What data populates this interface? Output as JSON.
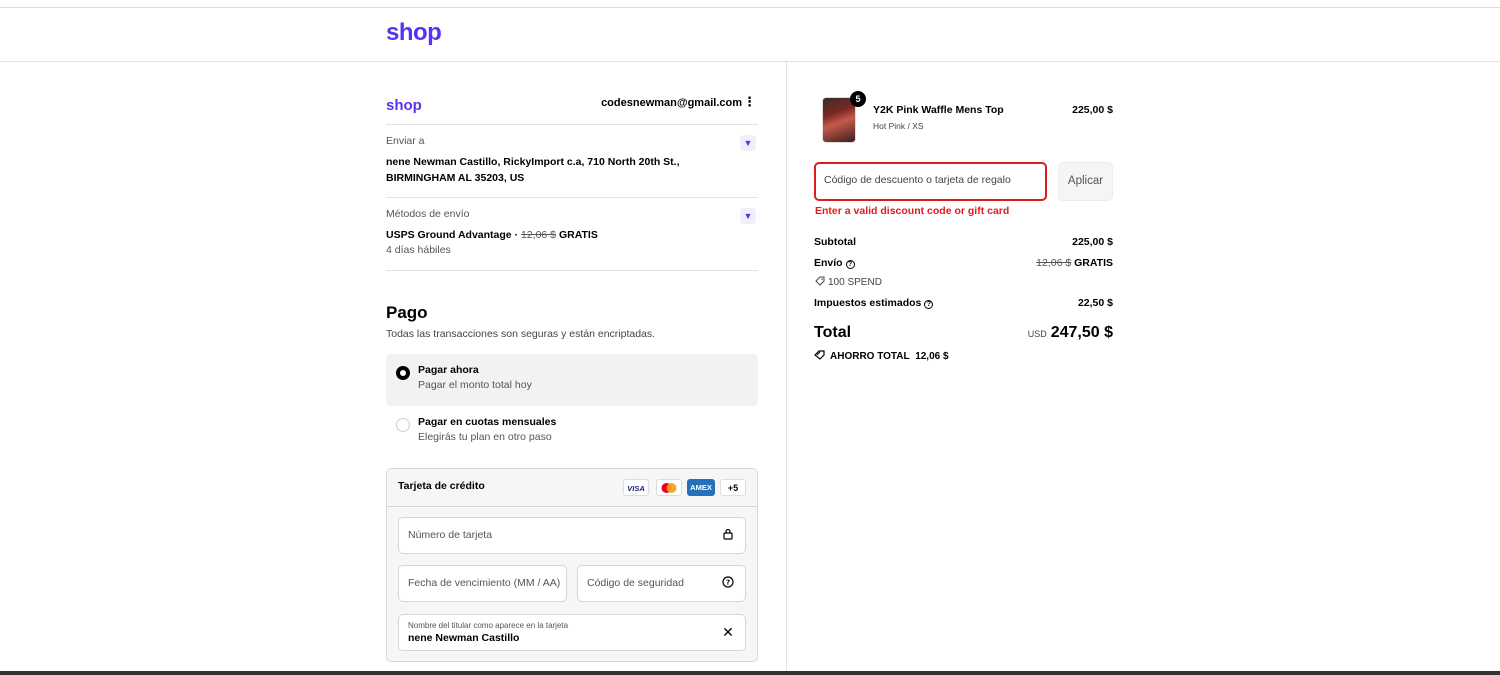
{
  "header": {
    "logo": "shop"
  },
  "account": {
    "logo": "shop",
    "email": "codesnewman@gmail.com",
    "menu_icon": "kebab-icon"
  },
  "shipping_address": {
    "label": "Enviar a",
    "line1": "nene Newman Castillo, RickyImport c.a, 710 North 20th St.,",
    "line2": "BIRMINGHAM AL 35203, US"
  },
  "shipping_method": {
    "label": "Métodos de envío",
    "name": "USPS Ground Advantage · ",
    "old_price": "12,06 $",
    "price": "GRATIS",
    "eta": "4 días hábiles"
  },
  "payment": {
    "title": "Pago",
    "subtitle": "Todas las transacciones son seguras y están encriptadas.",
    "options": [
      {
        "title": "Pagar ahora",
        "subtitle": "Pagar el monto total hoy",
        "selected": true
      },
      {
        "title": "Pagar en cuotas mensuales",
        "subtitle": "Elegirás tu plan en otro paso",
        "selected": false
      }
    ],
    "card": {
      "title": "Tarjeta de crédito",
      "brands": [
        "VISA",
        "MC",
        "AMEX",
        "+5"
      ],
      "number_placeholder": "Número de tarjeta",
      "expiry_placeholder": "Fecha de vencimiento (MM / AA)",
      "cvv_placeholder": "Código de seguridad",
      "name_label": "Nombre del titular como aparece en la tarjeta",
      "name_value": "nene Newman Castillo"
    }
  },
  "order": {
    "item": {
      "quantity": "5",
      "name": "Y2K Pink Waffle Mens Top",
      "variant": "Hot Pink / XS",
      "price": "225,00 $"
    },
    "discount_placeholder": "Código de descuento o tarjeta de regalo",
    "apply_label": "Aplicar",
    "error": "Enter a valid discount code or gift card",
    "subtotal_label": "Subtotal",
    "subtotal": "225,00 $",
    "shipping_label": "Envío",
    "shipping_old": "12,06 $",
    "shipping_value": "GRATIS",
    "promo": "100 SPEND",
    "taxes_label": "Impuestos estimados",
    "taxes": "22,50 $",
    "total_label": "Total",
    "currency": "USD",
    "total": "247,50 $",
    "savings_label": "AHORRO TOTAL",
    "savings": "12,06 $"
  },
  "colors": {
    "brand": "#5a31f4",
    "error": "#dd1d1d"
  }
}
